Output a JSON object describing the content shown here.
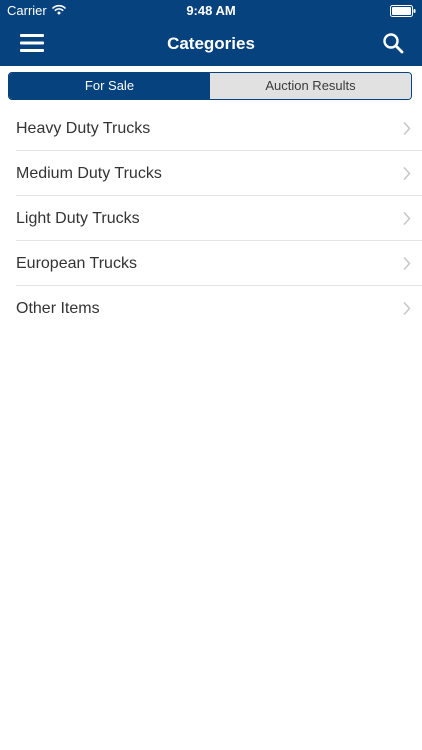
{
  "status_bar": {
    "carrier": "Carrier",
    "time": "9:48 AM",
    "wifi_icon": "wifi-icon",
    "battery_icon": "battery-icon"
  },
  "nav": {
    "title": "Categories",
    "menu_icon": "hamburger-menu-icon",
    "search_icon": "search-icon"
  },
  "tabs": [
    {
      "label": "For Sale",
      "selected": true
    },
    {
      "label": "Auction Results",
      "selected": false
    }
  ],
  "categories": [
    {
      "label": "Heavy Duty Trucks"
    },
    {
      "label": "Medium Duty Trucks"
    },
    {
      "label": "Light Duty Trucks"
    },
    {
      "label": "European Trucks"
    },
    {
      "label": "Other Items"
    }
  ],
  "colors": {
    "brand": "#06427d",
    "segment_inactive": "#e1e1e1",
    "separator": "#e4e4e4",
    "chevron": "#c7c7cc"
  }
}
